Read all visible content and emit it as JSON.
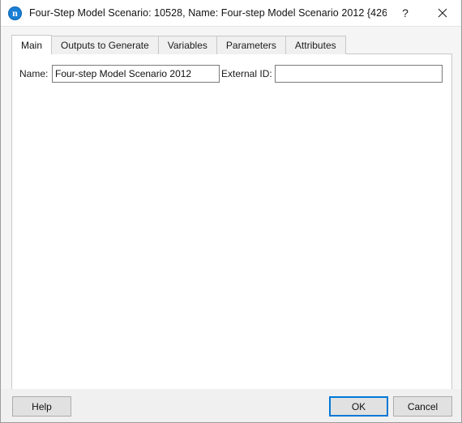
{
  "window": {
    "icon_name": "app-icon-n",
    "icon_glyph": "n",
    "title": "Four-Step Model Scenario: 10528, Name: Four-step Model Scenario 2012  {426270a...",
    "help_button_label": "?",
    "close_button_label": "✕",
    "accent_color": "#0078d7",
    "icon_color": "#1a7fd4"
  },
  "tabs": [
    {
      "label": "Main",
      "selected": true
    },
    {
      "label": "Outputs to Generate",
      "selected": false
    },
    {
      "label": "Variables",
      "selected": false
    },
    {
      "label": "Parameters",
      "selected": false
    },
    {
      "label": "Attributes",
      "selected": false
    }
  ],
  "main_tab": {
    "name_field": {
      "label": "Name:",
      "value": "Four-step Model Scenario 2012",
      "placeholder": ""
    },
    "external_id_field": {
      "label": "External ID:",
      "value": "",
      "placeholder": ""
    }
  },
  "footer": {
    "help_label": "Help",
    "ok_label": "OK",
    "cancel_label": "Cancel"
  }
}
